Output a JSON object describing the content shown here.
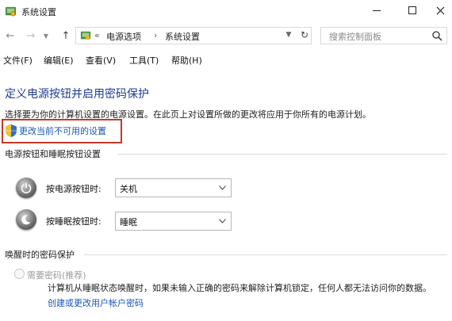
{
  "window": {
    "title": "系统设置"
  },
  "nav": {
    "breadcrumb": [
      "电源选项",
      "系统设置"
    ],
    "search_placeholder": "搜索控制面板"
  },
  "menu": {
    "items": [
      "文件(F)",
      "编辑(E)",
      "查看(V)",
      "工具(T)",
      "帮助(H)"
    ]
  },
  "content": {
    "heading": "定义电源按钮并启用密码保护",
    "description": "选择要为你的计算机设置的电源设置。在此页上对设置所做的更改将应用于你所有的电源计划。",
    "change_link": "更改当前不可用的设置",
    "buttons_group": {
      "title": "电源按钮和睡眠按钮设置",
      "power_label": "按电源按钮时:",
      "power_value": "关机",
      "sleep_label": "按睡眠按钮时:",
      "sleep_value": "睡眠"
    },
    "password_group": {
      "title": "唤醒时的密码保护",
      "require_label": "需要密码(推荐)",
      "require_desc": "计算机从睡眠状态唤醒时，如果未输入正确的密码来解除计算机锁定，任何人都无法访问你的数据。",
      "create_link": "创建或更改用户帐户密码"
    }
  },
  "colors": {
    "heading": "#1e3d8f",
    "link": "#1a56b6",
    "highlight_border": "#c0392b"
  }
}
